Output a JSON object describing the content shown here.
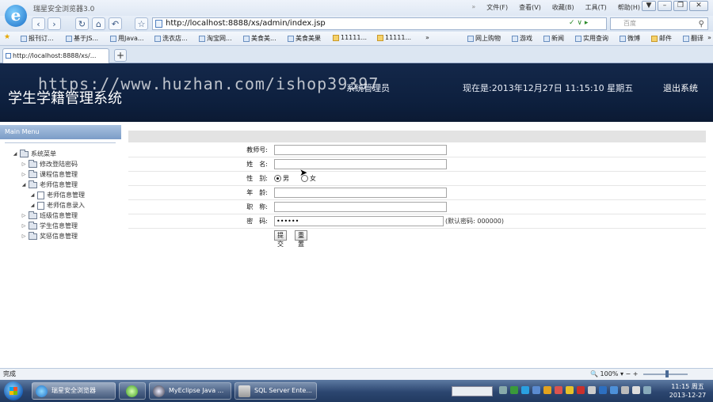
{
  "browser": {
    "app_title": "瑞星安全浏览器3.0",
    "menu": [
      "文件(F)",
      "查看(V)",
      "收藏(B)",
      "工具(T)",
      "帮助(H)"
    ],
    "menu_more": "»",
    "window_buttons": [
      "▼",
      "–",
      "❐",
      "✕"
    ],
    "nav": {
      "back": "‹",
      "forward": "›",
      "refresh": "↻",
      "home": "⌂",
      "undo": "↶",
      "favorite": "☆"
    },
    "url": "http://localhost:8888/xs/admin/index.jsp",
    "address_tools": "✓ ∨ ▸",
    "search_placeholder": "百度",
    "search_icon": "⚲",
    "favorites": [
      "报刊订...",
      "基于JS...",
      "用Java...",
      "洗衣店...",
      "淘宝网...",
      "美食美...",
      "美食美果",
      "11111...",
      "11111...",
      "»",
      "网上购物",
      "游戏",
      "新闻",
      "实用查询",
      "微博",
      "邮件",
      "翻译",
      "»"
    ],
    "tab_title": "http://localhost:8888/xs/...",
    "new_tab": "+"
  },
  "header": {
    "system_title": "学生学籍管理系统",
    "watermark": "https://www.huzhan.com/ishop39397",
    "role": "系统管理员",
    "datetime": "现在是:2013年12月27日 11:15:10 星期五",
    "logout": "退出系统"
  },
  "sidebar": {
    "title": "Main Menu",
    "root": "系统菜单",
    "items": {
      "change_password": "修改登陆密码",
      "course_info": "课程信息管理",
      "teacher_info": "老师信息管理",
      "teacher_manage": "老师信息管理",
      "teacher_entry": "老师信息录入",
      "class_info": "班级信息管理",
      "student_info": "学生信息管理",
      "reward_info": "奖惩信息管理"
    }
  },
  "form": {
    "fields": {
      "teacher_id": {
        "label": "教师号:",
        "value": ""
      },
      "name": {
        "label": "姓　名:",
        "value": ""
      },
      "gender": {
        "label": "性　别:",
        "male": "男",
        "female": "女",
        "selected": "男"
      },
      "age": {
        "label": "年　龄:",
        "value": ""
      },
      "title": {
        "label": "职　称:",
        "value": ""
      },
      "password": {
        "label": "密　码:",
        "value": "000000",
        "hint": "(默认密码: 000000)"
      }
    },
    "submit": "提交",
    "reset": "重置"
  },
  "statusbar": {
    "status": "完成",
    "zoom": "100%",
    "zoom_prefix": "🔍",
    "zoom_controls": "▾  −                     +"
  },
  "taskbar": {
    "tasks": [
      "瑞星安全浏览器",
      "MyEclipse Java ...",
      "SQL Server Ente..."
    ],
    "time": "11:15 周五",
    "date": "2013-12-27"
  }
}
